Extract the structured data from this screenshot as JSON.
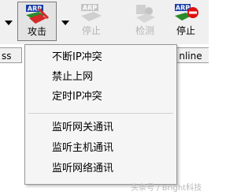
{
  "toolbar": {
    "attack": {
      "badge": "ARP",
      "label": "攻击",
      "state": "active"
    },
    "stop_attack": {
      "badge": "ARP",
      "label": "停止",
      "state": "disabled"
    },
    "detect": {
      "label": "检测",
      "state": "disabled"
    },
    "stop": {
      "badge": "ARP",
      "label": "停止",
      "state": "active"
    }
  },
  "header": {
    "left_fragment": "ss",
    "right_fragment": "nline"
  },
  "menu": {
    "items": [
      {
        "label": "不断IP冲突"
      },
      {
        "label": "禁止上网"
      },
      {
        "label": "定时IP冲突"
      },
      {
        "label": "监听网关通讯"
      },
      {
        "label": "监听主机通讯"
      },
      {
        "label": "监听网络通讯"
      }
    ]
  },
  "watermark": "头条号 / Bright科技",
  "colors": {
    "toolbar_bg": "#f0f0f0",
    "menu_bg": "#f5f5f5",
    "disabled_text": "#b4b4b4",
    "badge_blue": "#1a3fa8",
    "stop_red": "#e01010"
  }
}
